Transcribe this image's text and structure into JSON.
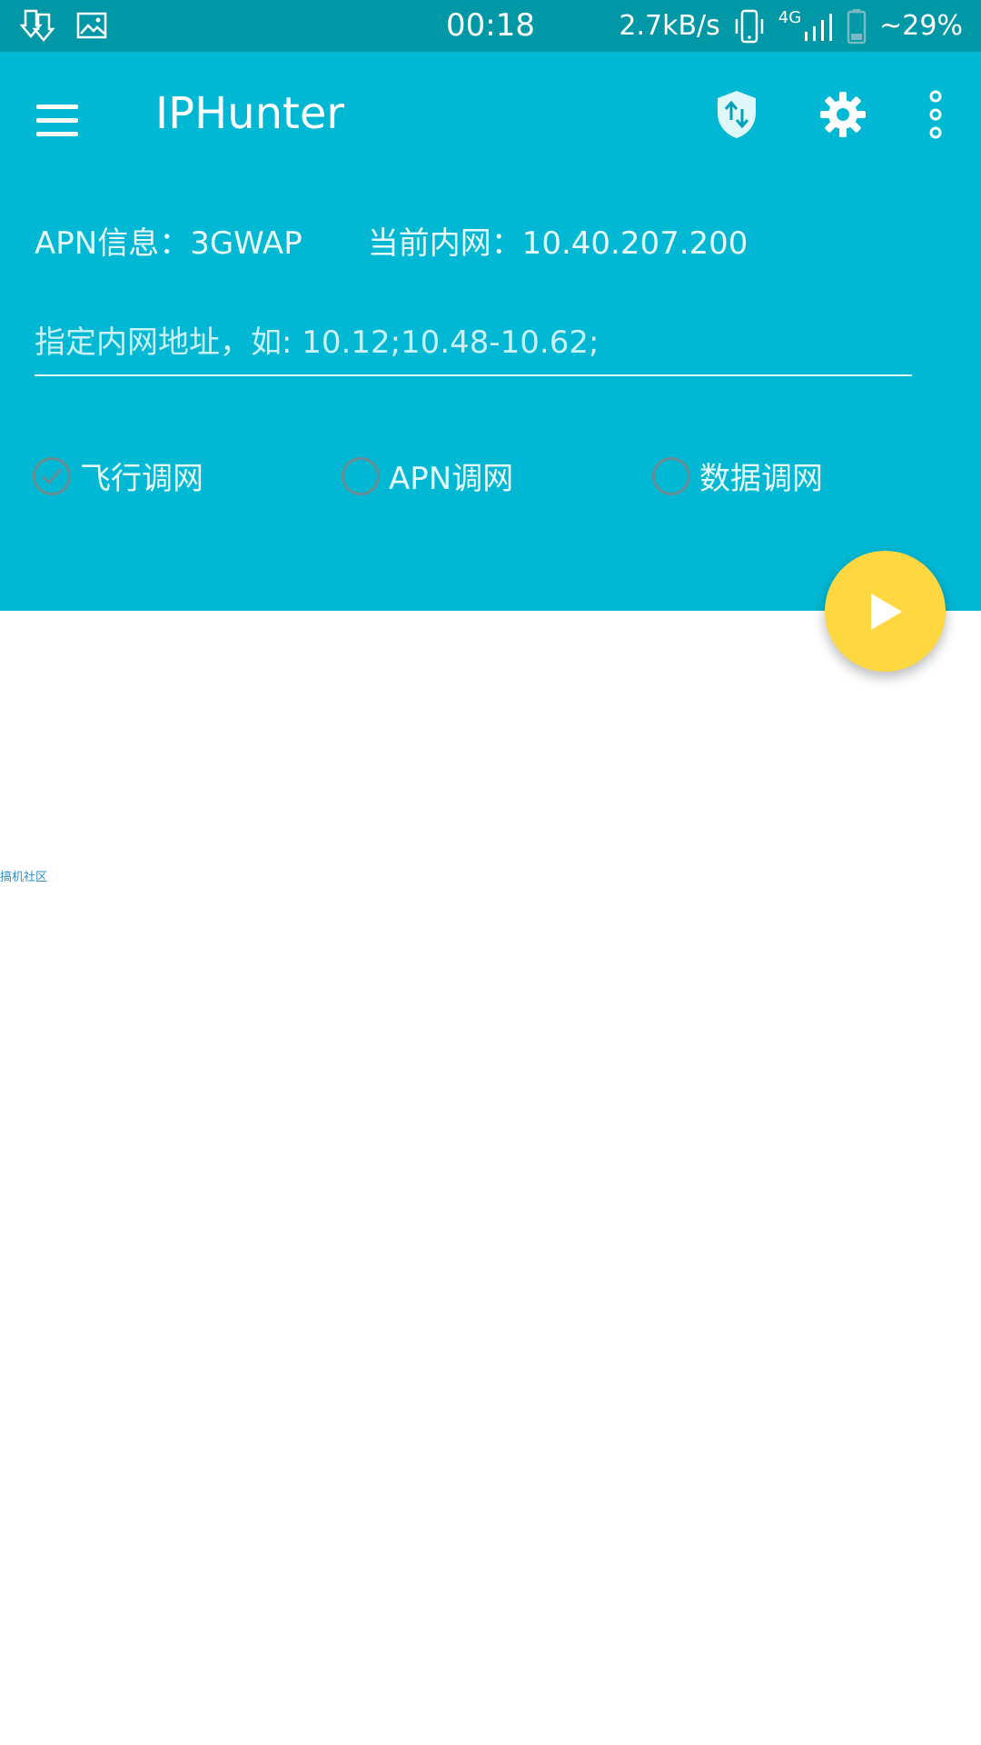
{
  "status_bar": {
    "time": "00:18",
    "speed": "2.7kB/s",
    "network": "4G",
    "battery": "~29%",
    "left_icons": [
      "download-icon",
      "image-icon"
    ],
    "right_icons": [
      "vibrate-icon",
      "signal-icon",
      "battery-icon"
    ]
  },
  "app_bar": {
    "title": "IPHunter",
    "icons": [
      "menu-icon",
      "shield-transfer-icon",
      "gear-icon",
      "more-vert-icon"
    ],
    "background": "#00b8d4"
  },
  "info": {
    "apn": "APN信息：3GWAP",
    "lan_ip": "当前内网：10.40.207.200"
  },
  "range_input": {
    "value": "",
    "placeholder": "指定内网地址，如: 10.12;10.48-10.62;"
  },
  "mode_options": [
    {
      "label": "飞行调网",
      "checked": true
    },
    {
      "label": "APN调网",
      "checked": false
    },
    {
      "label": "数据调网",
      "checked": false
    }
  ],
  "fab": {
    "icon": "play-icon",
    "color": "#ffd740"
  },
  "watermark": "搞机社区"
}
